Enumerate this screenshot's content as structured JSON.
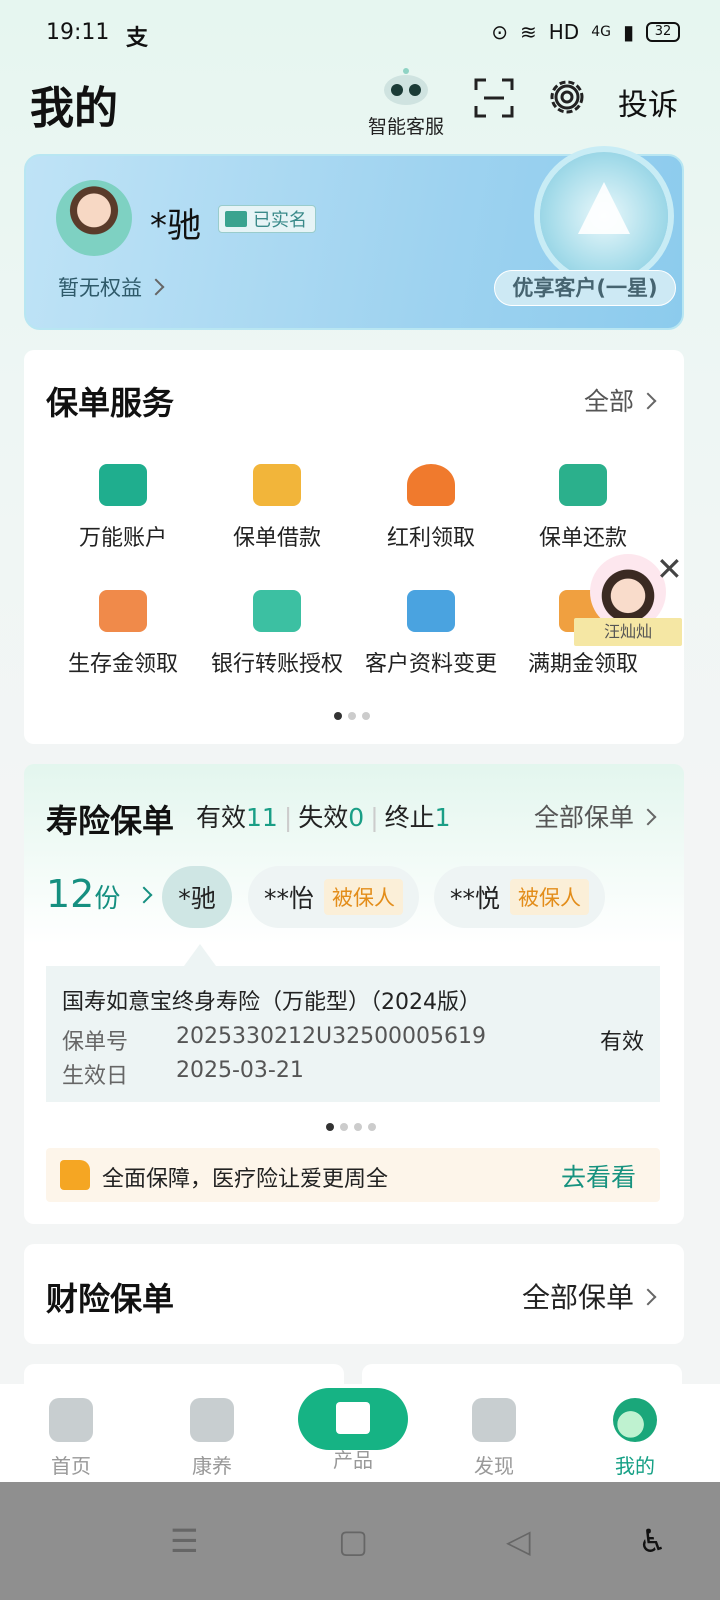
{
  "status_bar": {
    "time": "19:11",
    "app_icon": "支",
    "network": "HD",
    "cell": "4G",
    "battery": "32"
  },
  "header": {
    "title": "我的",
    "customer_service": "智能客服",
    "complain": "投诉"
  },
  "member": {
    "name": "*驰",
    "verified": "已实名",
    "rights": "暂无权益",
    "tier": "优享客户(一星)"
  },
  "policy_service": {
    "title": "保单服务",
    "all": "全部",
    "items": [
      {
        "label": "万能账户",
        "color": "#1fae8e"
      },
      {
        "label": "保单借款",
        "color": "#f2b53a"
      },
      {
        "label": "红利领取",
        "color": "#f07a2d"
      },
      {
        "label": "保单还款",
        "color": "#2bb08c"
      },
      {
        "label": "生存金领取",
        "color": "#f08a4a"
      },
      {
        "label": "银行转账授权",
        "color": "#3cc0a2"
      },
      {
        "label": "客户资料变更",
        "color": "#4aa3e0"
      },
      {
        "label": "满期金领取",
        "color": "#f0a040"
      }
    ]
  },
  "agent": {
    "name": "汪灿灿",
    "close": "✕"
  },
  "life": {
    "title": "寿险保单",
    "valid_label": "有效",
    "valid": "11",
    "lapsed_label": "失效",
    "lapsed": "0",
    "terminated_label": "终止",
    "terminated": "1",
    "all": "全部保单",
    "count": "12",
    "count_unit": "份",
    "chips": [
      {
        "name": "*驰",
        "tag": ""
      },
      {
        "name": "**怡",
        "tag": "被保人"
      },
      {
        "name": "**悦",
        "tag": "被保人"
      }
    ],
    "policy": {
      "name": "国寿如意宝终身寿险（万能型）（2024版）",
      "no_label": "保单号",
      "no": "2025330212U32500005619",
      "status": "有效",
      "date_label": "生效日",
      "date": "2025-03-21"
    },
    "promo": {
      "text": "全面保障，医疗险让爱更周全",
      "action": "去看看"
    }
  },
  "property": {
    "title": "财险保单",
    "all": "全部保单"
  },
  "nav": [
    {
      "label": "首页"
    },
    {
      "label": "康养"
    },
    {
      "label": "产品"
    },
    {
      "label": "发现"
    },
    {
      "label": "我的"
    }
  ],
  "colors": {
    "accent": "#15a085",
    "tag_text": "#e38d1a"
  }
}
